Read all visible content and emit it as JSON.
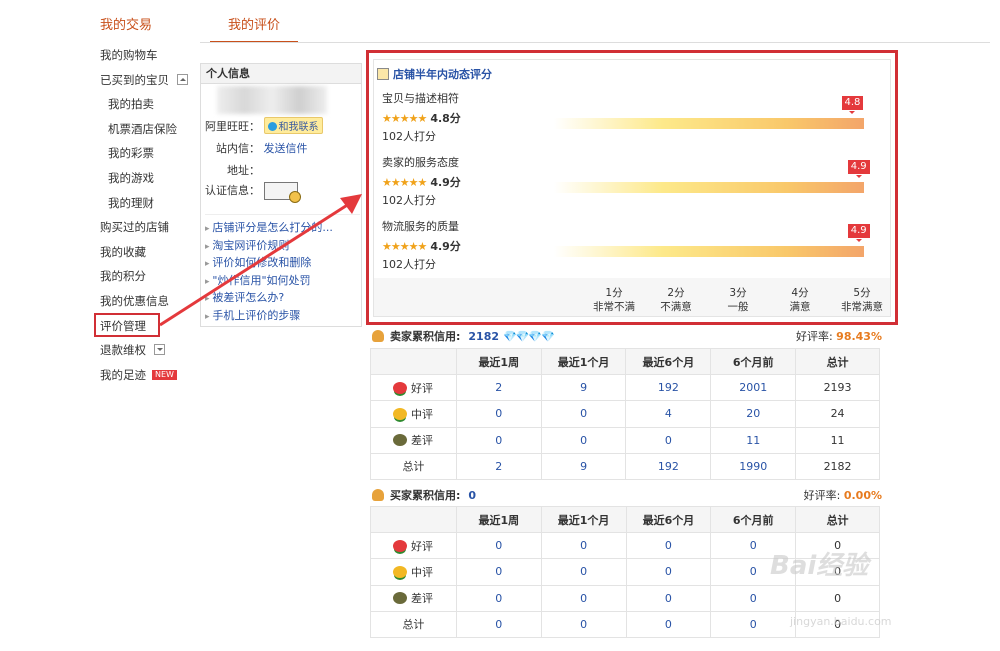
{
  "sidebar": {
    "heading": "我的交易",
    "items": [
      {
        "label": "我的购物车",
        "sub": false
      },
      {
        "label": "已买到的宝贝",
        "sub": false,
        "toggle": "up"
      },
      {
        "label": "我的拍卖",
        "sub": true
      },
      {
        "label": "机票酒店保险",
        "sub": true
      },
      {
        "label": "我的彩票",
        "sub": true
      },
      {
        "label": "我的游戏",
        "sub": true
      },
      {
        "label": "我的理财",
        "sub": true
      },
      {
        "label": "购买过的店铺",
        "sub": false
      },
      {
        "label": "我的收藏",
        "sub": false
      },
      {
        "label": "我的积分",
        "sub": false
      },
      {
        "label": "我的优惠信息",
        "sub": false
      },
      {
        "label": "评价管理",
        "sub": false,
        "highlight": true
      },
      {
        "label": "退款维权",
        "sub": false,
        "toggle": "down"
      },
      {
        "label": "我的足迹",
        "sub": false,
        "badge": "NEW"
      }
    ]
  },
  "tab": {
    "label": "我的评价"
  },
  "personal": {
    "title": "个人信息",
    "wangwang_label": "阿里旺旺：",
    "wangwang_button": "和我联系",
    "mail_label": "站内信：",
    "mail_link": "发送信件",
    "address_label": "地址：",
    "cert_label": "认证信息：",
    "links": [
      "店铺评分是怎么打分的...",
      "淘宝网评价规则",
      "评价如何修改和删除",
      "\"炒作信用\"如何处罚",
      "被差评怎么办?",
      "手机上评价的步骤"
    ]
  },
  "dsr": {
    "title": "店铺半年内动态评分",
    "metrics": [
      {
        "name": "宝贝与描述相符",
        "stars": "★★★★★",
        "score_text": "4.8分",
        "count": "102人打分",
        "pin": "4.8",
        "value": 4.8
      },
      {
        "name": "卖家的服务态度",
        "stars": "★★★★★",
        "score_text": "4.9分",
        "count": "102人打分",
        "pin": "4.9",
        "value": 4.9
      },
      {
        "name": "物流服务的质量",
        "stars": "★★★★★",
        "score_text": "4.9分",
        "count": "102人打分",
        "pin": "4.9",
        "value": 4.9
      }
    ],
    "scale": [
      {
        "score": "1分",
        "desc": "非常不满"
      },
      {
        "score": "2分",
        "desc": "不满意"
      },
      {
        "score": "3分",
        "desc": "一般"
      },
      {
        "score": "4分",
        "desc": "满意"
      },
      {
        "score": "5分",
        "desc": "非常满意"
      }
    ]
  },
  "seller_credit": {
    "label": "卖家累积信用:",
    "value": "2182",
    "diamonds": "💎💎💎💎",
    "rate_label": "好评率:",
    "rate": "98.43%",
    "headers": [
      "",
      "最近1周",
      "最近1个月",
      "最近6个月",
      "6个月前",
      "总计"
    ],
    "rows": [
      {
        "label": "好评",
        "icon": "good",
        "cells": [
          "2",
          "9",
          "192",
          "2001",
          "2193"
        ]
      },
      {
        "label": "中评",
        "icon": "mid",
        "cells": [
          "0",
          "0",
          "4",
          "20",
          "24"
        ]
      },
      {
        "label": "差评",
        "icon": "bad",
        "cells": [
          "0",
          "0",
          "0",
          "11",
          "11"
        ]
      },
      {
        "label": "总计",
        "icon": "",
        "cells": [
          "2",
          "9",
          "192",
          "1990",
          "2182"
        ]
      }
    ]
  },
  "buyer_credit": {
    "label": "买家累积信用:",
    "value": "0",
    "rate_label": "好评率:",
    "rate": "0.00%",
    "headers": [
      "",
      "最近1周",
      "最近1个月",
      "最近6个月",
      "6个月前",
      "总计"
    ],
    "rows": [
      {
        "label": "好评",
        "icon": "good",
        "cells": [
          "0",
          "0",
          "0",
          "0",
          "0"
        ]
      },
      {
        "label": "中评",
        "icon": "mid",
        "cells": [
          "0",
          "0",
          "0",
          "0",
          "0"
        ]
      },
      {
        "label": "差评",
        "icon": "bad",
        "cells": [
          "0",
          "0",
          "0",
          "0",
          "0"
        ]
      },
      {
        "label": "总计",
        "icon": "",
        "cells": [
          "0",
          "0",
          "0",
          "0",
          "0"
        ]
      }
    ]
  },
  "watermark": {
    "brand": "Bai经验",
    "url": "jingyan.baidu.com"
  },
  "colors": {
    "accent": "#c8501b",
    "highlight_red": "#d12f35",
    "link": "#2953a6"
  }
}
